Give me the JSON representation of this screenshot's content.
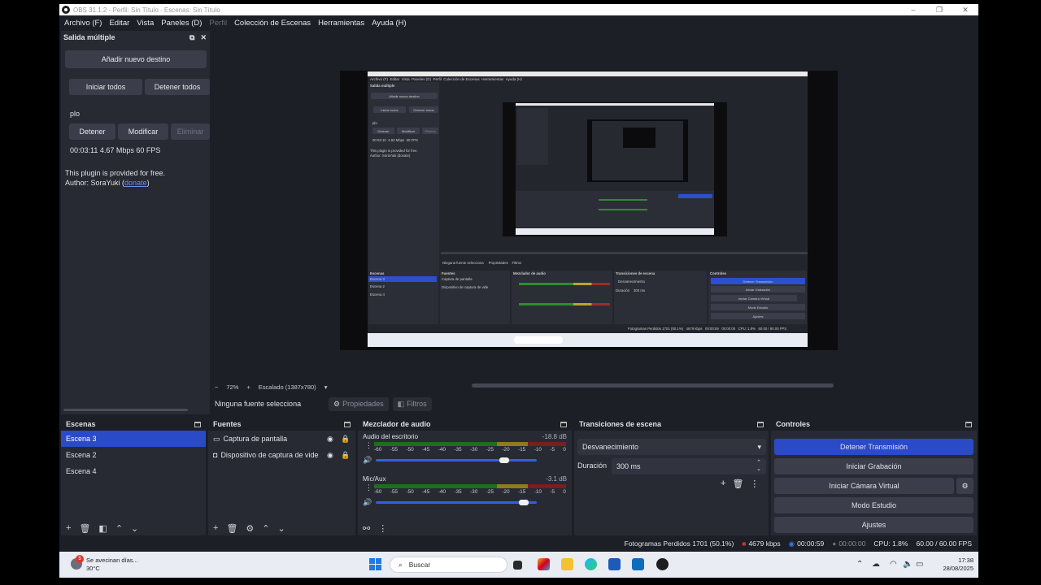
{
  "window": {
    "title": "OBS 31.1.2 - Perfil: Sin Título - Escenas: Sin Título",
    "controls": [
      "–",
      "❐",
      "✕"
    ]
  },
  "menu": [
    "Archivo (F)",
    "Editar",
    "Vista",
    "Paneles (D)",
    "Perfil",
    "Colección de Escenas",
    "Herramientas",
    "Ayuda (H)"
  ],
  "multi_output": {
    "title": "Salida múltiple",
    "add_button": "Añadir nuevo destino",
    "start_all": "Iniciar todos",
    "stop_all": "Detener todos",
    "target_name": "plo",
    "stop": "Detener",
    "modify": "Modificar",
    "delete": "Eliminar",
    "stats": "00:03:11  4.67 Mbps  60 FPS",
    "free_text": "This plugin is provided for free.",
    "author_prefix": "Author: SoraYuki (",
    "author_link": "donate",
    "author_suffix": ")"
  },
  "preview": {
    "zoom_minus": "−",
    "zoom": "72%",
    "zoom_plus": "+",
    "scaling": "Escalado (1387x780)",
    "scaling_arrow": "▾"
  },
  "context": {
    "no_source": "Ninguna fuente selecciona",
    "properties": "Propiedades",
    "filters": "Filtros"
  },
  "scenes": {
    "title": "Escenas",
    "items": [
      "Escena 3",
      "Escena 2",
      "Escena 4"
    ]
  },
  "sources": {
    "title": "Fuentes",
    "items": [
      "Captura de pantalla",
      "Dispositivo de captura de vide"
    ]
  },
  "mixer": {
    "title": "Mezclador de audio",
    "channels": [
      {
        "name": "Audio del escritorio",
        "db": "-18.8 dB",
        "level": 0.8
      },
      {
        "name": "Mic/Aux",
        "db": "-3.1 dB",
        "level": 0.92
      }
    ],
    "scale": [
      "-60",
      "-55",
      "-50",
      "-45",
      "-40",
      "-35",
      "-30",
      "-25",
      "-20",
      "-15",
      "-10",
      "-5",
      "0"
    ]
  },
  "transitions": {
    "title": "Transiciones de escena",
    "selected": "Desvanecimiento",
    "duration_label": "Duración",
    "duration_value": "300 ms"
  },
  "controls": {
    "title": "Controles",
    "stop_stream": "Detener Transmisión",
    "start_recording": "Iniciar Grabación",
    "start_vcam": "Iniciar Cámara Virtual",
    "studio_mode": "Modo Estudio",
    "settings": "Ajustes"
  },
  "status": {
    "dropped": "Fotogramas Perdidos 1701 (50.1%)",
    "bitrate": "4679 kbps",
    "stream_time": "00:00:59",
    "rec_time": "00:00:00",
    "cpu": "CPU: 1.8%",
    "fps": "60.00 / 60.00 FPS"
  },
  "taskbar": {
    "weather_title": "Se avecinan días...",
    "weather_temp": "30°C",
    "badge": "5",
    "search": "Buscar",
    "time": "17:38",
    "date": "28/08/2025"
  },
  "colors": {
    "accent": "#2a4ac8",
    "bg": "#1d1f26",
    "panel": "#272a33",
    "button": "#3b3e4a"
  }
}
